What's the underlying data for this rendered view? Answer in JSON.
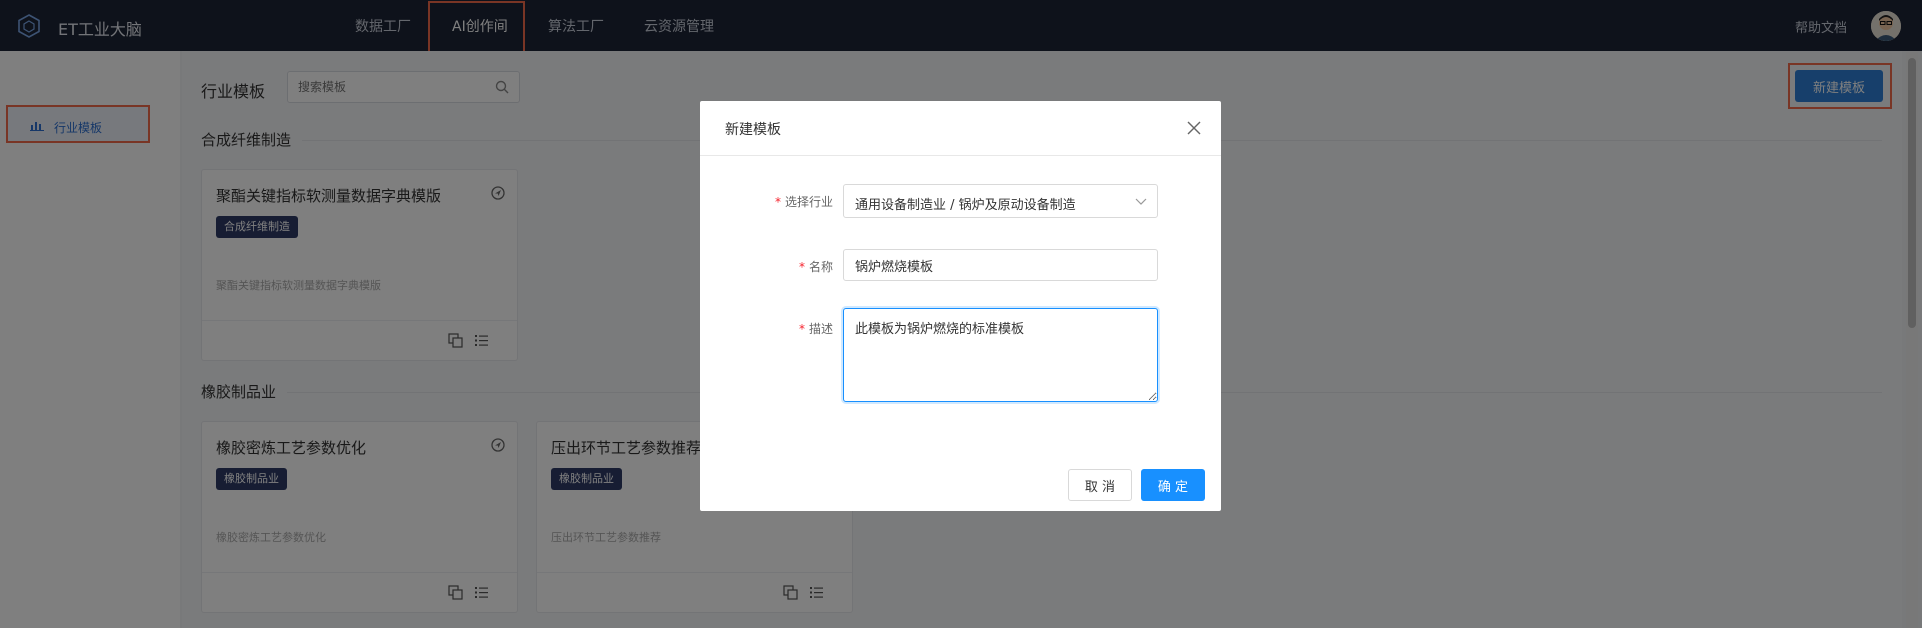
{
  "header": {
    "brand": "ET工业大脑",
    "nav": [
      {
        "label": "数据工厂",
        "active": false
      },
      {
        "label": "AI创作间",
        "active": true
      },
      {
        "label": "算法工厂",
        "active": false
      },
      {
        "label": "云资源管理",
        "active": false
      }
    ],
    "help": "帮助文档",
    "logo_icon": "cube-logo-icon"
  },
  "sidebar": {
    "items": [
      {
        "label": "行业模板",
        "icon": "bar-chart-icon",
        "active": true
      }
    ]
  },
  "main": {
    "title": "行业模板",
    "search": {
      "placeholder": "搜索模板",
      "value": ""
    },
    "new_button": "新建模板",
    "sections": [
      {
        "title": "合成纤维制造",
        "cards": [
          {
            "title": "聚酯关键指标软测量数据字典模版",
            "tag": "合成纤维制造",
            "desc": "聚酯关键指标软测量数据字典模版"
          }
        ]
      },
      {
        "title": "橡胶制品业",
        "cards": [
          {
            "title": "橡胶密炼工艺参数优化",
            "tag": "橡胶制品业",
            "desc": "橡胶密炼工艺参数优化"
          },
          {
            "title": "压出环节工艺参数推荐",
            "tag": "橡胶制品业",
            "desc": "压出环节工艺参数推荐"
          }
        ]
      }
    ]
  },
  "modal": {
    "title": "新建模板",
    "fields": {
      "industry": {
        "label": "选择行业",
        "value": "通用设备制造业 / 锅炉及原动设备制造"
      },
      "name": {
        "label": "名称",
        "value": "锅炉燃烧模板"
      },
      "desc": {
        "label": "描述",
        "value": "此模板为锅炉燃烧的标准模板"
      }
    },
    "cancel": "取 消",
    "ok": "确 定"
  },
  "colors": {
    "topbar": "#1d2536",
    "primary": "#1890ff",
    "highlight": "#f26b4b",
    "tag": "#2e3b67"
  }
}
